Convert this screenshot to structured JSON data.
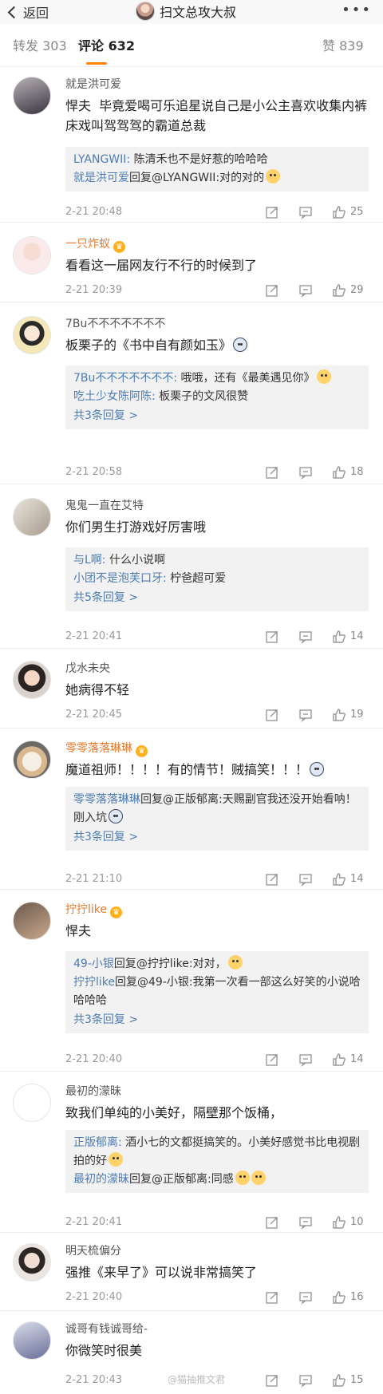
{
  "header": {
    "back_label": "返回",
    "title": "扫文总攻大叔",
    "more": "•••"
  },
  "tabs": [
    {
      "label": "转发 303"
    },
    {
      "label": "评论 632"
    },
    {
      "label": "赞 839"
    }
  ],
  "comments": [
    {
      "name": "就是洪可爱",
      "text": "悍夫  毕竟爱喝可乐追星说自己是小公主喜欢收集内裤床戏叫驾驾驾的霸道总裁",
      "replies": [
        {
          "name": "LYANGWII:",
          "text": " 陈清禾也不是好惹的哈哈哈"
        },
        {
          "name": "就是洪可爱",
          "text": "回复@LYANGWII:对的对的"
        }
      ],
      "time": "2-21 20:48",
      "likes": "25"
    },
    {
      "name": "一只炸蚁",
      "text": "看看这一届网友行不行的时候到了",
      "time": "2-21 20:39",
      "likes": "29"
    },
    {
      "name": "7Bu不不不不不不不",
      "text": "板栗子的《书中自有颜如玉》",
      "replies": [
        {
          "name": "7Bu不不不不不不不:",
          "text": " 哦哦，还有《最美遇见你》"
        },
        {
          "name": "吃土少女陈阿陈:",
          "text": " 板栗子的文风很赞"
        }
      ],
      "more": "共3条回复 >",
      "time": "2-21 20:58",
      "likes": "18"
    },
    {
      "name": "鬼鬼一直在艾特",
      "text": "你们男生打游戏好厉害哦",
      "replies": [
        {
          "name": "与L啊:",
          "text": " 什么小说啊"
        },
        {
          "name": "小团不是泡芙口牙:",
          "text": " 柠爸超可爱"
        }
      ],
      "more": "共5条回复 >",
      "time": "2-21 20:41",
      "likes": "14"
    },
    {
      "name": "戊水未央",
      "text": "她病得不轻",
      "time": "2-21 20:45",
      "likes": "19"
    },
    {
      "name": "零零落落琳琳",
      "text": "魔道祖师！！！！有的情节！贼搞笑！！！",
      "replies": [
        {
          "name": "零零落落琳琳",
          "text": "回复@正版郁离:天赐副官我还没开始看呐！刚入坑"
        }
      ],
      "more": "共3条回复 >",
      "time": "2-21 21:10",
      "likes": "14"
    },
    {
      "name": "拧拧like",
      "text": "悍夫",
      "replies": [
        {
          "name": "49-小银",
          "text": "回复@拧拧like:对对，"
        },
        {
          "name": "拧拧like",
          "text": "回复@49-小银:我第一次看一部这么好笑的小说哈哈哈哈"
        }
      ],
      "more": "共3条回复 >",
      "time": "2-21 20:40",
      "likes": "14"
    },
    {
      "name": "最初的濛昧",
      "text": "致我们单纯的小美好，隔壁那个饭桶，",
      "replies": [
        {
          "name": "正版郁离:",
          "text": " 酒小七的文都挺搞笑的。小美好感觉书比电视剧拍的好"
        },
        {
          "name": "最初的濛昧",
          "text": "回复@正版郁离:同感"
        }
      ],
      "time": "2-21 20:41",
      "likes": "10"
    },
    {
      "name": "明天梳偏分",
      "text": "强推《来早了》可以说非常搞笑了",
      "time": "2-21 20:40",
      "likes": "16"
    },
    {
      "name": "诚哥有钱诚哥给-",
      "text": "你微笑时很美",
      "time": "2-21 20:43",
      "likes": "15"
    }
  ],
  "watermark": "@猫抽推文君",
  "colors": {
    "accent": "#ff8200",
    "link": "#4d7cb3",
    "vip_name": "#e8792c"
  }
}
